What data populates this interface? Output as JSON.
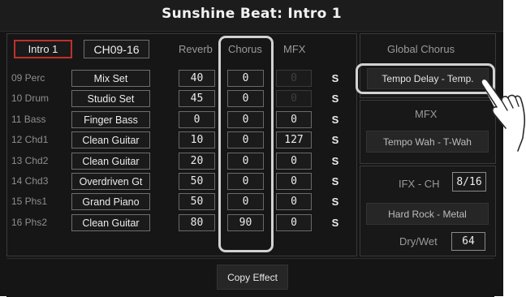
{
  "title": "Sunshine Beat: Intro 1",
  "tabs": {
    "section": "Intro 1",
    "channels": "CH09-16"
  },
  "headers": {
    "reverb": "Reverb",
    "chorus": "Chorus",
    "mfx": "MFX"
  },
  "rows": [
    {
      "ch": "09 Perc",
      "voice": "Mix Set",
      "reverb": "40",
      "chorus": "0",
      "mfx": "0",
      "mfx_disabled": true,
      "s": "S"
    },
    {
      "ch": "10 Drum",
      "voice": "Studio Set",
      "reverb": "45",
      "chorus": "0",
      "mfx": "0",
      "mfx_disabled": true,
      "s": "S"
    },
    {
      "ch": "11 Bass",
      "voice": "Finger Bass",
      "reverb": "0",
      "chorus": "0",
      "mfx": "0",
      "mfx_disabled": false,
      "s": "S"
    },
    {
      "ch": "12 Chd1",
      "voice": "Clean Guitar",
      "reverb": "10",
      "chorus": "0",
      "mfx": "127",
      "mfx_disabled": false,
      "s": "S"
    },
    {
      "ch": "13 Chd2",
      "voice": "Clean Guitar",
      "reverb": "20",
      "chorus": "0",
      "mfx": "0",
      "mfx_disabled": false,
      "s": "S"
    },
    {
      "ch": "14 Chd3",
      "voice": "Overdriven Gt",
      "reverb": "50",
      "chorus": "0",
      "mfx": "0",
      "mfx_disabled": false,
      "s": "S"
    },
    {
      "ch": "15 Phs1",
      "voice": "Grand Piano",
      "reverb": "50",
      "chorus": "0",
      "mfx": "0",
      "mfx_disabled": false,
      "s": "S"
    },
    {
      "ch": "16 Phs2",
      "voice": "Clean Guitar",
      "reverb": "80",
      "chorus": "90",
      "mfx": "0",
      "mfx_disabled": false,
      "s": "S"
    }
  ],
  "global_chorus": {
    "label": "Global Chorus",
    "value": "Tempo Delay - Temp."
  },
  "mfx": {
    "label": "MFX",
    "value": "Tempo Wah - T-Wah"
  },
  "ifx": {
    "label": "IFX - CH",
    "value": "8/16",
    "type": "Hard Rock - Metal",
    "drywet_label": "Dry/Wet",
    "drywet_value": "64"
  },
  "footer": {
    "copy_effect": "Copy Effect"
  },
  "colors": {
    "background": "#151515",
    "accent_red": "#c0302a",
    "highlight": "#d2d2d2"
  },
  "icons": {
    "pointer": "pointing-hand-icon"
  }
}
